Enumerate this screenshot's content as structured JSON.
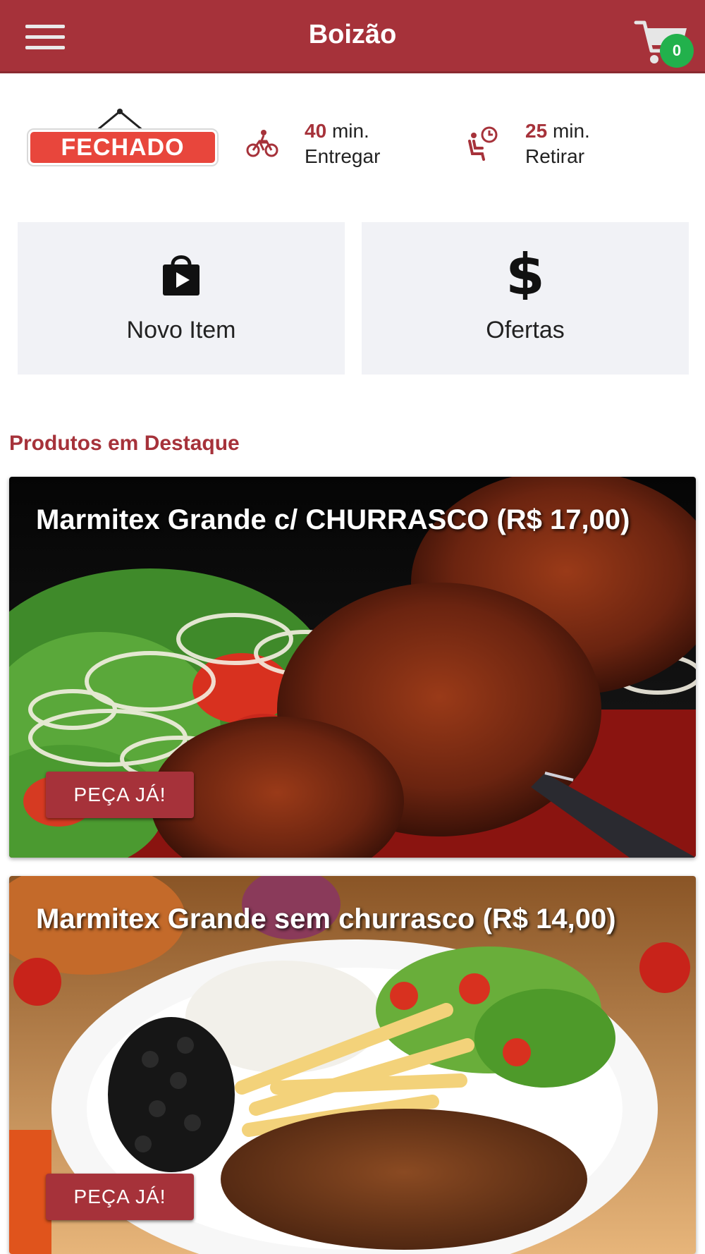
{
  "header": {
    "title": "Boizão",
    "cart_count": "0"
  },
  "status": {
    "closed_label": "FECHADO",
    "delivery": {
      "minutes": "40",
      "unit": "min.",
      "label": "Entregar"
    },
    "pickup": {
      "minutes": "25",
      "unit": "min.",
      "label": "Retirar"
    }
  },
  "tiles": [
    {
      "label": "Novo Item",
      "icon": "shopping-bag-play-icon"
    },
    {
      "label": "Ofertas",
      "icon": "dollar-icon"
    }
  ],
  "section_title": "Produtos em Destaque",
  "products": [
    {
      "title": "Marmitex Grande c/ CHURRASCO (R$ 17,00)",
      "button": "PEÇA JÁ!"
    },
    {
      "title": "Marmitex Grande sem churrasco (R$ 14,00)",
      "button": "PEÇA JÁ!"
    }
  ],
  "colors": {
    "brand": "#a6323a",
    "badge": "#22b14c",
    "closed": "#e8463c",
    "tile_bg": "#f1f2f6"
  }
}
